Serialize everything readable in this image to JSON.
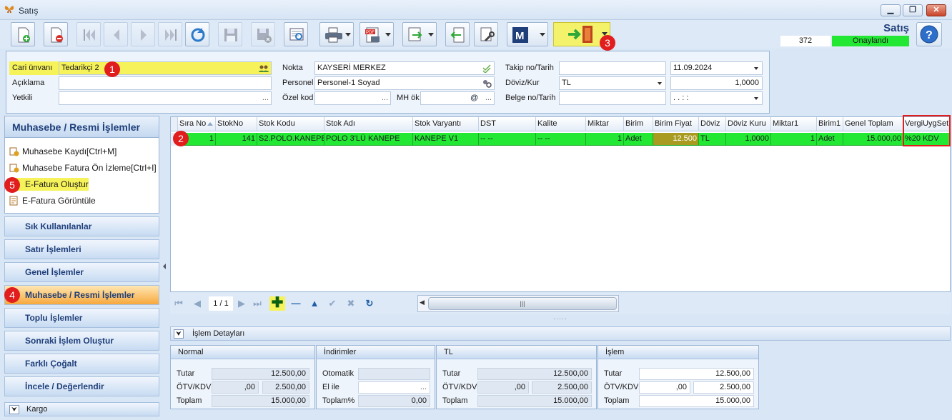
{
  "window": {
    "title": "Satış",
    "minimize": "▁",
    "restore": "❐",
    "close": "✕"
  },
  "document": {
    "title": "Satış",
    "number": "372",
    "status": "Onaylandı",
    "status_color": "#23e833"
  },
  "callouts": [
    "1",
    "2",
    "3",
    "4",
    "5"
  ],
  "form": {
    "cari_label": "Cari ünvanı",
    "cari_value": "Tedarikçi 2",
    "aciklama_label": "Açıklama",
    "aciklama_value": "",
    "yetkili_label": "Yetkili",
    "yetkili_value": "",
    "nokta_label": "Nokta",
    "nokta_value": "KAYSERİ MERKEZ",
    "personel_label": "Personel",
    "personel_value": "Personel-1 Soyad",
    "ozelkod_label": "Özel kod",
    "ozelkod_value": "",
    "mhok_label": "MH ök",
    "mhok_value": "",
    "mhok_at": "@",
    "takip_label": "Takip no/Tarih",
    "takip_value": "",
    "takip_date": "11.09.2024",
    "doviz_label": "Döviz/Kur",
    "doviz_value": "TL",
    "doviz_kur": "1,0000",
    "belge_label": "Belge no/Tarih",
    "belge_value": "",
    "belge_date": ". .   : :",
    "ellipsis": "..."
  },
  "left_panel": {
    "header": "Muhasebe / Resmi İşlemler",
    "items": [
      {
        "label": "Muhasebe Kaydı[Ctrl+M]"
      },
      {
        "label": "Muhasebe Fatura Ön İzleme[Ctrl+I]"
      },
      {
        "label": "E-Fatura Oluştur"
      },
      {
        "label": "E-Fatura Görüntüle"
      }
    ],
    "groups": [
      {
        "label": "Sık Kullanılanlar"
      },
      {
        "label": "Satır İşlemleri"
      },
      {
        "label": "Genel İşlemler"
      },
      {
        "label": "Muhasebe / Resmi İşlemler"
      },
      {
        "label": "Toplu İşlemler"
      },
      {
        "label": "Sonraki İşlem Oluştur"
      },
      {
        "label": "Farklı Çoğalt"
      },
      {
        "label": "İncele / Değerlendir"
      }
    ],
    "kargo": "Kargo",
    "chevron": "⮟"
  },
  "grid": {
    "columns": [
      "Sıra No",
      "StokNo",
      "Stok Kodu",
      "Stok Adı",
      "Stok Varyantı",
      "DST",
      "Kalite",
      "Miktar",
      "Birim",
      "Birim Fiyat",
      "Döviz",
      "Döviz Kuru",
      "Miktar1",
      "Birim1",
      "Genel Toplam",
      "VergiUygSet"
    ],
    "rows": [
      [
        "1",
        "141",
        "S2.POLO.KANEPE",
        "POLO 3'LÜ KANEPE",
        "KANEPE V1",
        "-- --",
        "-- --",
        "1",
        "Adet",
        "12.500",
        "TL",
        "1,0000",
        "1",
        "Adet",
        "15.000,00",
        "%20 KDV"
      ]
    ]
  },
  "navigator": {
    "page": "1 / 1",
    "first": "⏮",
    "prev": "◀",
    "next": "▶",
    "last": "⏭",
    "add": "✚",
    "remove": "—",
    "up": "▲",
    "ok": "✔",
    "cancel": "✖",
    "refresh": "↻",
    "scroll_left": "◀",
    "scroll_grip": "|||"
  },
  "details": {
    "header": "İşlem Detayları",
    "boxes": [
      {
        "title": "Normal",
        "rows": [
          {
            "label": "Tutar",
            "v1": "",
            "v2": "12.500,00"
          },
          {
            "label": "ÖTV/KDV",
            "v1": ",00",
            "v2": "2.500,00"
          },
          {
            "label": "Toplam",
            "v1": "",
            "v2": "15.000,00"
          }
        ]
      },
      {
        "title": "İndirimler",
        "rows": [
          {
            "label": "Otomatik",
            "v1": "",
            "v2": ""
          },
          {
            "label": "El ile",
            "v1": "",
            "v2": "..."
          },
          {
            "label": "Toplam%",
            "v1": "",
            "v2": "0,00"
          }
        ]
      },
      {
        "title": "TL",
        "rows": [
          {
            "label": "Tutar",
            "v1": "",
            "v2": "12.500,00"
          },
          {
            "label": "ÖTV/KDV",
            "v1": ",00",
            "v2": "2.500,00"
          },
          {
            "label": "Toplam",
            "v1": "",
            "v2": "15.000,00"
          }
        ]
      },
      {
        "title": "İşlem",
        "rows": [
          {
            "label": "Tutar",
            "v1": "",
            "v2": "12.500,00"
          },
          {
            "label": "ÖTV/KDV",
            "v1": ",00",
            "v2": "2.500,00"
          },
          {
            "label": "Toplam",
            "v1": "",
            "v2": "15.000,00"
          }
        ]
      }
    ]
  },
  "icons": [
    "new-document-icon",
    "delete-document-icon",
    "first-record-icon",
    "previous-record-icon",
    "next-record-icon",
    "last-record-icon",
    "refresh-icon",
    "save-icon",
    "save-close-icon",
    "preview-icon",
    "print-icon",
    "pdf-icon",
    "export-icon",
    "import-icon",
    "tools-icon",
    "m-logo-icon",
    "exit-door-icon",
    "help-icon"
  ]
}
